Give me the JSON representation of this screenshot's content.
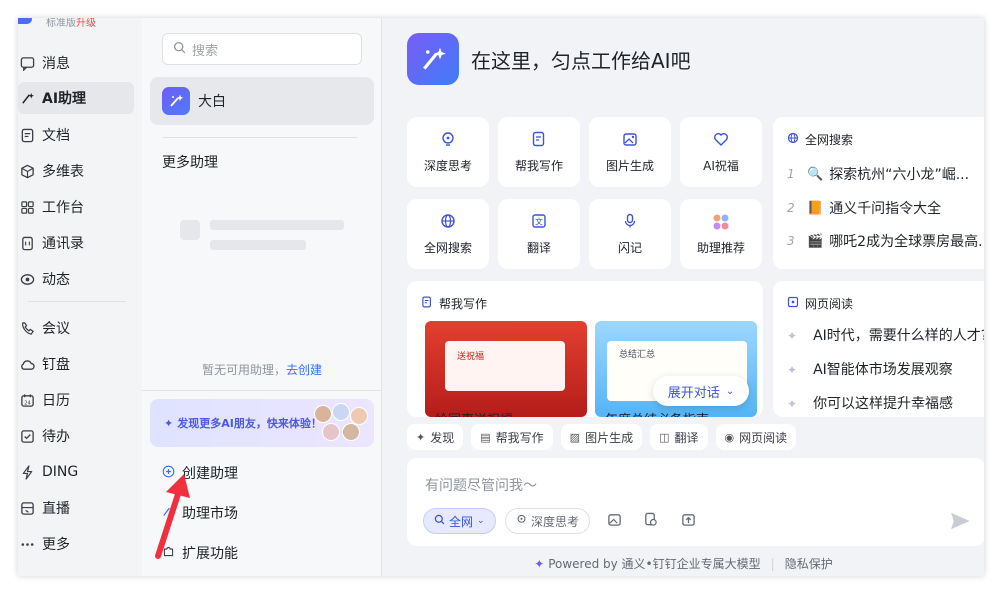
{
  "topstrip": {
    "edition": "标准版",
    "upgrade": "升级"
  },
  "nav": {
    "items": [
      {
        "label": "消息",
        "icon": "message-icon"
      },
      {
        "label": "AI助理",
        "icon": "ai-assistant-icon"
      },
      {
        "label": "文档",
        "icon": "document-icon"
      },
      {
        "label": "多维表",
        "icon": "multi-table-icon"
      },
      {
        "label": "工作台",
        "icon": "workbench-icon"
      },
      {
        "label": "通讯录",
        "icon": "contacts-icon"
      },
      {
        "label": "动态",
        "icon": "activity-icon"
      },
      {
        "label": "会议",
        "icon": "meeting-icon"
      },
      {
        "label": "钉盘",
        "icon": "cloud-drive-icon"
      },
      {
        "label": "日历",
        "icon": "calendar-icon"
      },
      {
        "label": "待办",
        "icon": "todo-icon"
      },
      {
        "label": "DING",
        "icon": "ding-icon"
      },
      {
        "label": "直播",
        "icon": "live-icon"
      },
      {
        "label": "更多",
        "icon": "more-icon"
      }
    ]
  },
  "assistants": {
    "search_placeholder": "搜索",
    "current": "大白",
    "more_title": "更多助理",
    "empty_text": "暂无可用助理，",
    "create_link": "去创建",
    "banner": "发现更多AI朋友，快来体验！",
    "links": [
      {
        "label": "创建助理",
        "icon": "plus-circle-icon"
      },
      {
        "label": "助理市场",
        "icon": "market-icon"
      },
      {
        "label": "扩展功能",
        "icon": "extension-icon"
      }
    ]
  },
  "main": {
    "hero_title": "在这里，匀点工作给AI吧",
    "tiles": [
      {
        "label": "深度思考",
        "icon": "bulb-icon"
      },
      {
        "label": "帮我写作",
        "icon": "write-icon"
      },
      {
        "label": "图片生成",
        "icon": "image-gen-icon"
      },
      {
        "label": "AI祝福",
        "icon": "heart-icon"
      },
      {
        "label": "全网搜索",
        "icon": "globe-icon"
      },
      {
        "label": "翻译",
        "icon": "translate-icon"
      },
      {
        "label": "闪记",
        "icon": "mic-icon"
      },
      {
        "label": "助理推荐",
        "icon": "avatars-icon"
      }
    ],
    "web_search": {
      "title": "全网搜索",
      "items": [
        {
          "rank": "1",
          "emoji": "🔍",
          "text": "探索杭州“六小龙”崛..."
        },
        {
          "rank": "2",
          "emoji": "📙",
          "text": "通义千问指令大全"
        },
        {
          "rank": "3",
          "emoji": "🎬",
          "text": "哪吒2成为全球票房最高..."
        }
      ]
    },
    "writing": {
      "title": "帮我写作",
      "cards": [
        {
          "tag": "送祝福",
          "caption": "给同事送祝福"
        },
        {
          "tag": "总结汇总",
          "caption": "年度总结必备指南"
        }
      ],
      "expand_label": "展开对话"
    },
    "web_reading": {
      "title": "网页阅读",
      "items": [
        "AI时代，需要什么样的人才?",
        "AI智能体市场发展观察",
        "你可以这样提升幸福感"
      ]
    },
    "chips": [
      {
        "label": "发现",
        "icon": "sparkle-icon"
      },
      {
        "label": "帮我写作",
        "icon": "write-icon"
      },
      {
        "label": "图片生成",
        "icon": "image-gen-icon"
      },
      {
        "label": "翻译",
        "icon": "translate-icon"
      },
      {
        "label": "网页阅读",
        "icon": "eye-icon"
      }
    ],
    "composer": {
      "placeholder": "有问题尽管问我～",
      "net_label": "全网",
      "deep_label": "深度思考"
    },
    "footer": {
      "powered": "Powered by 通义•钉钉企业专属大模型",
      "privacy": "隐私保护"
    }
  },
  "colors": {
    "accent": "#3d53d6",
    "link": "#3370ff",
    "sidebar_bg": "#f3f4f6"
  }
}
